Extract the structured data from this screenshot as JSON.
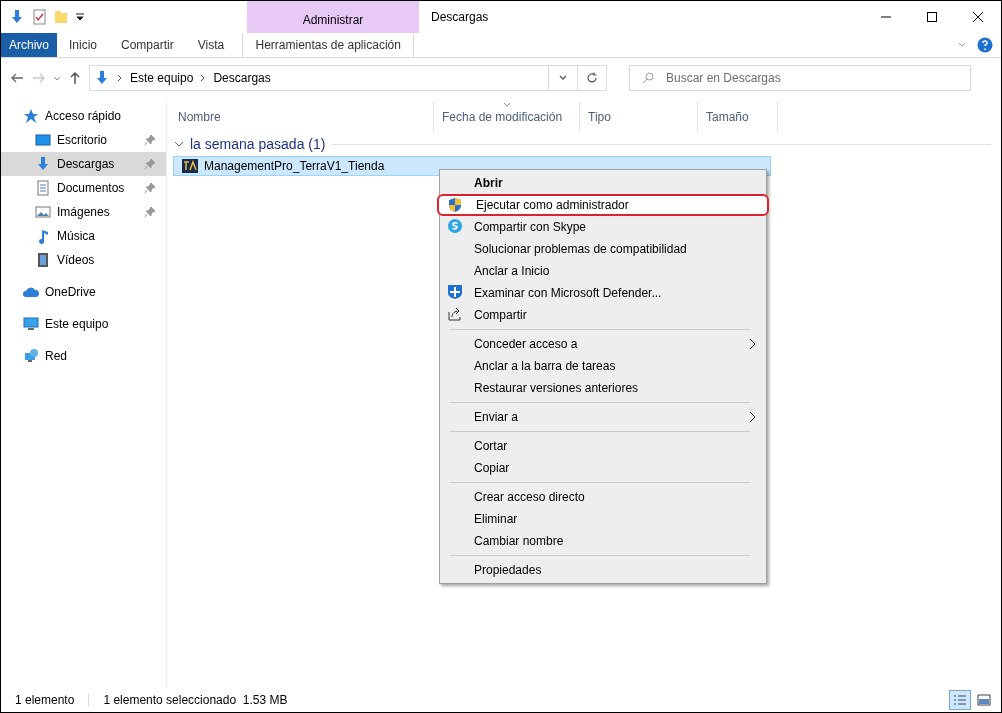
{
  "window": {
    "title": "Descargas"
  },
  "ribbon": {
    "contextual_group": "Administrar",
    "tabs": [
      {
        "label": "Archivo",
        "selected": false,
        "kind": "file"
      },
      {
        "label": "Inicio",
        "selected": false,
        "kind": "tab"
      },
      {
        "label": "Compartir",
        "selected": false,
        "kind": "tab"
      },
      {
        "label": "Vista",
        "selected": false,
        "kind": "tab"
      },
      {
        "label": "Herramientas de aplicación",
        "selected": false,
        "kind": "contextual"
      }
    ]
  },
  "address": {
    "path": [
      "Este equipo",
      "Descargas"
    ]
  },
  "search": {
    "placeholder": "Buscar en Descargas"
  },
  "sidebar": {
    "items": [
      {
        "label": "Acceso rápido",
        "selected": false,
        "pinned": false,
        "children": [
          {
            "label": "Escritorio",
            "selected": false,
            "pinned": true
          },
          {
            "label": "Descargas",
            "selected": true,
            "pinned": true
          },
          {
            "label": "Documentos",
            "selected": false,
            "pinned": true
          },
          {
            "label": "Imágenes",
            "selected": false,
            "pinned": true
          },
          {
            "label": "Música",
            "selected": false,
            "pinned": false
          },
          {
            "label": "Vídeos",
            "selected": false,
            "pinned": false
          }
        ]
      },
      {
        "label": "OneDrive",
        "selected": false,
        "pinned": false
      },
      {
        "label": "Este equipo",
        "selected": false,
        "pinned": false
      },
      {
        "label": "Red",
        "selected": false,
        "pinned": false
      }
    ]
  },
  "table": {
    "columns": [
      {
        "label": "Nombre",
        "sorted": false
      },
      {
        "label": "Fecha de modificación",
        "sorted": true
      },
      {
        "label": "Tipo",
        "sorted": false
      },
      {
        "label": "Tamaño",
        "sorted": false
      }
    ],
    "groups": [
      {
        "label": "la semana pasada (1)",
        "expanded": true,
        "rows": [
          {
            "name": "ManagementPro_TerraV1_Tienda",
            "selected": true
          }
        ]
      }
    ]
  },
  "context_menu": {
    "items": [
      {
        "kind": "item",
        "label": "Abrir",
        "bold": true,
        "highlighted": false,
        "submenu": false
      },
      {
        "kind": "item",
        "label": "Ejecutar como administrador",
        "bold": false,
        "highlighted": true,
        "submenu": false
      },
      {
        "kind": "item",
        "label": "Compartir con Skype",
        "bold": false,
        "highlighted": false,
        "submenu": false
      },
      {
        "kind": "item",
        "label": "Solucionar problemas de compatibilidad",
        "bold": false,
        "highlighted": false,
        "submenu": false
      },
      {
        "kind": "item",
        "label": "Anclar a Inicio",
        "bold": false,
        "highlighted": false,
        "submenu": false
      },
      {
        "kind": "item",
        "label": "Examinar con Microsoft Defender...",
        "bold": false,
        "highlighted": false,
        "submenu": false
      },
      {
        "kind": "item",
        "label": "Compartir",
        "bold": false,
        "highlighted": false,
        "submenu": false
      },
      {
        "kind": "separator"
      },
      {
        "kind": "item",
        "label": "Conceder acceso a",
        "bold": false,
        "highlighted": false,
        "submenu": true
      },
      {
        "kind": "item",
        "label": "Anclar a la barra de tareas",
        "bold": false,
        "highlighted": false,
        "submenu": false
      },
      {
        "kind": "item",
        "label": "Restaurar versiones anteriores",
        "bold": false,
        "highlighted": false,
        "submenu": false
      },
      {
        "kind": "separator"
      },
      {
        "kind": "item",
        "label": "Enviar a",
        "bold": false,
        "highlighted": false,
        "submenu": true
      },
      {
        "kind": "separator"
      },
      {
        "kind": "item",
        "label": "Cortar",
        "bold": false,
        "highlighted": false,
        "submenu": false
      },
      {
        "kind": "item",
        "label": "Copiar",
        "bold": false,
        "highlighted": false,
        "submenu": false
      },
      {
        "kind": "separator"
      },
      {
        "kind": "item",
        "label": "Crear acceso directo",
        "bold": false,
        "highlighted": false,
        "submenu": false
      },
      {
        "kind": "item",
        "label": "Eliminar",
        "bold": false,
        "highlighted": false,
        "submenu": false
      },
      {
        "kind": "item",
        "label": "Cambiar nombre",
        "bold": false,
        "highlighted": false,
        "submenu": false
      },
      {
        "kind": "separator"
      },
      {
        "kind": "item",
        "label": "Propiedades",
        "bold": false,
        "highlighted": false,
        "submenu": false
      }
    ]
  },
  "status_bar": {
    "count": "1 elemento",
    "selection": "1 elemento seleccionado  1.53 MB",
    "details_view": true
  }
}
